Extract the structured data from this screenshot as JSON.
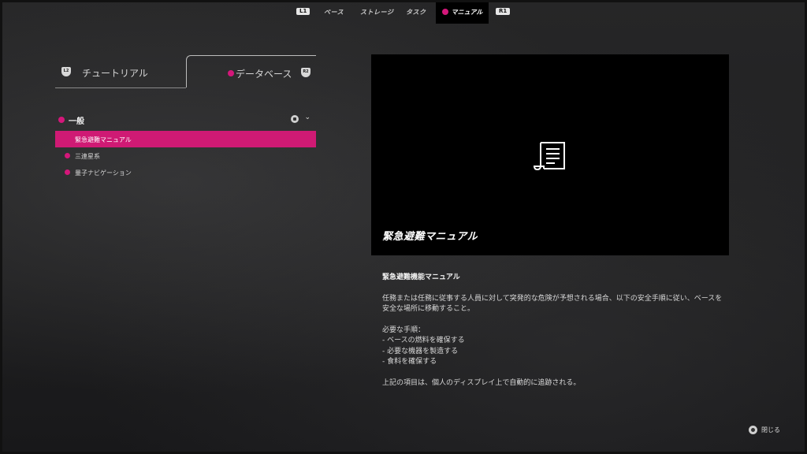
{
  "nav": {
    "l1": "L1",
    "r1": "R1",
    "tabs": [
      "ベース",
      "ストレージ",
      "タスク"
    ],
    "active_tab": "マニュアル"
  },
  "panel": {
    "tab_tutorial": "チュートリアル",
    "tab_database": "データベース",
    "l2": "L2",
    "r2": "R2",
    "section": "一般",
    "items": [
      {
        "label": "緊急避難マニュアル",
        "selected": true
      },
      {
        "label": "三連星系",
        "selected": false
      },
      {
        "label": "量子ナビゲーション",
        "selected": false
      }
    ]
  },
  "preview": {
    "title": "緊急避難マニュアル",
    "icon": "document-scroll-icon"
  },
  "description": {
    "heading": "緊急避難機能マニュアル",
    "para1": "任務または任務に従事する人員に対して突発的な危険が予想される場合、以下の安全手順に従い、ベースを安全な場所に移動すること。",
    "steps_title": "必要な手順：",
    "steps": [
      "- ベースの燃料を確保する",
      "- 必要な機器を製造する",
      "- 食料を確保する"
    ],
    "footer": "上記の項目は、個人のディスプレイ上で自動的に追跡される。"
  },
  "close": {
    "label": "閉じる",
    "icon": "circle-button-icon"
  },
  "colors": {
    "accent": "#cf1a74",
    "background": "#1e1e1f",
    "panel": "#000000"
  }
}
